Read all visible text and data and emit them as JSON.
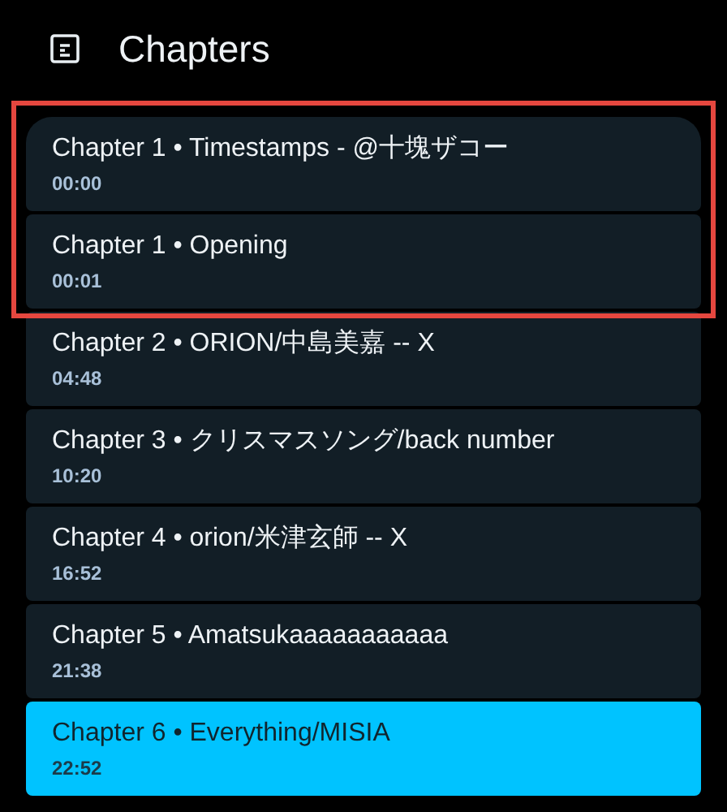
{
  "header": {
    "title": "Chapters"
  },
  "chapters": [
    {
      "title": "Chapter 1 • Timestamps - @十塊ザコー",
      "time": "00:00",
      "selected": false,
      "highlighted": true
    },
    {
      "title": "Chapter 1 • Opening",
      "time": "00:01",
      "selected": false,
      "highlighted": true
    },
    {
      "title": "Chapter 2 • ORION/中島美嘉 -- X",
      "time": "04:48",
      "selected": false,
      "highlighted": false
    },
    {
      "title": "Chapter 3 • クリスマスソング/back number",
      "time": "10:20",
      "selected": false,
      "highlighted": false
    },
    {
      "title": "Chapter 4 • orion/米津玄師 -- X",
      "time": "16:52",
      "selected": false,
      "highlighted": false
    },
    {
      "title": "Chapter 5 • Amatsukaaaaaaaaaaa",
      "time": "21:38",
      "selected": false,
      "highlighted": false
    },
    {
      "title": "Chapter 6 • Everything/MISIA",
      "time": "22:52",
      "selected": true,
      "highlighted": false
    }
  ]
}
